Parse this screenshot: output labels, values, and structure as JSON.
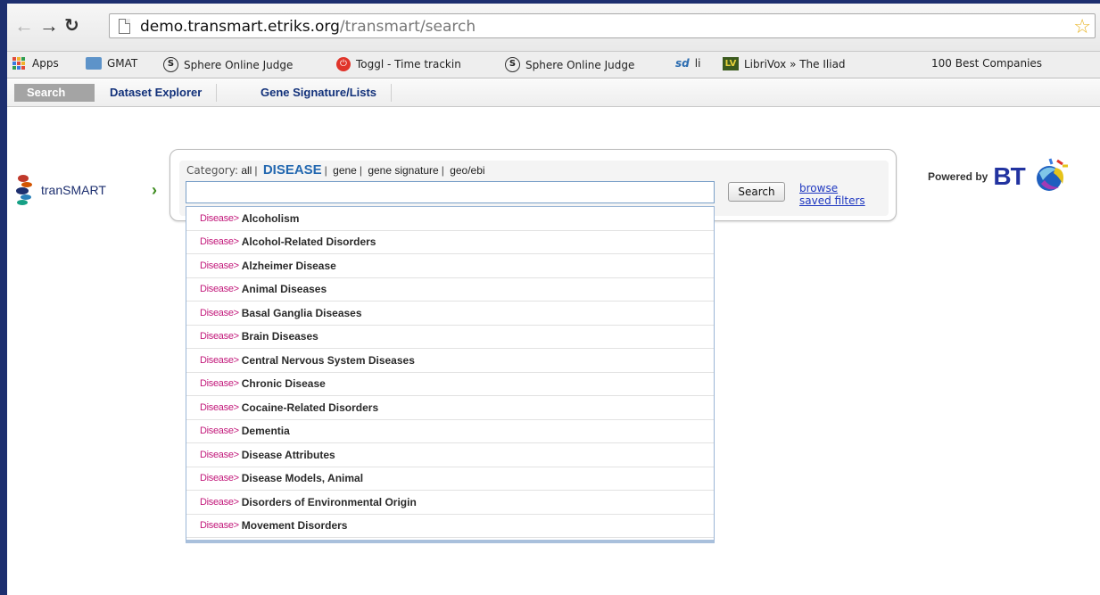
{
  "browser": {
    "url_host": "demo.transmart.etriks.org",
    "url_path": "/transmart/search",
    "bookmarks": [
      {
        "label": "Apps",
        "icon": "apps-grid-icon"
      },
      {
        "label": "GMAT",
        "icon": "folder-icon"
      },
      {
        "label": "Sphere Online Judge",
        "icon": "sphere-judge-icon"
      },
      {
        "label": "Toggl - Time trackin",
        "icon": "toggl-icon"
      },
      {
        "label": "Sphere Online Judge",
        "icon": "sphere-judge-icon"
      },
      {
        "label": "li",
        "icon": "sd-icon"
      },
      {
        "label": "LibriVox » The Iliad",
        "icon": "librivox-icon"
      },
      {
        "label": "100 Best Companies",
        "icon": "none"
      }
    ]
  },
  "tabs": {
    "search": "Search",
    "dataset_explorer": "Dataset Explorer",
    "gene_signature": "Gene Signature/Lists"
  },
  "logo": {
    "name": "tranSMART"
  },
  "search": {
    "category_label": "Category:",
    "categories": [
      "all",
      "DISEASE",
      "gene",
      "gene signature",
      "geo/ebi"
    ],
    "selected_category": "DISEASE",
    "input_value": "",
    "button_label": "Search",
    "browse_link_line1": "browse",
    "browse_link_line2": "saved filters"
  },
  "powered_by": {
    "label": "Powered by",
    "brand": "BT"
  },
  "suggestions": {
    "category_prefix": "Disease>",
    "items": [
      "Alcoholism",
      "Alcohol-Related Disorders",
      "Alzheimer Disease",
      "Animal Diseases",
      "Basal Ganglia Diseases",
      "Brain Diseases",
      "Central Nervous System Diseases",
      "Chronic Disease",
      "Cocaine-Related Disorders",
      "Dementia",
      "Disease Attributes",
      "Disease Models, Animal",
      "Disorders of Environmental Origin",
      "Movement Disorders"
    ]
  },
  "colors": {
    "frame": "#1d2f6f",
    "tab_text": "#12317a",
    "selected_category": "#2368b0",
    "suggestion_prefix": "#c2187a",
    "bt_brand": "#2233a0"
  }
}
